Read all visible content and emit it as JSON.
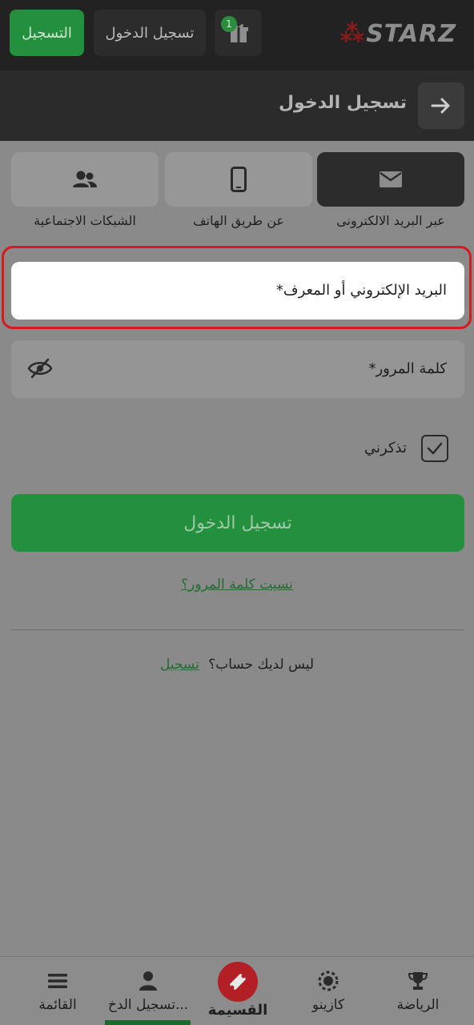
{
  "header": {
    "register_label": "التسجيل",
    "login_label": "تسجيل الدخول",
    "gift_count": "1",
    "logo_mark": "⁂",
    "logo_text": "STARZ"
  },
  "titlebar": {
    "title": "تسجيل الدخول"
  },
  "tabs": [
    {
      "label": "عبر البريد الالكترونى",
      "icon": "envelope-icon",
      "active": true
    },
    {
      "label": "عن طريق الهاتف",
      "icon": "phone-icon",
      "active": false
    },
    {
      "label": "الشبكات الاجتماعية",
      "icon": "users-icon",
      "active": false
    }
  ],
  "form": {
    "email_label": "البريد الإلكتروني أو المعرف*",
    "password_label": "كلمة المرور*",
    "remember_label": "تذكرني",
    "submit_label": "تسجيل الدخول",
    "forgot_label": "نسيت كلمة المرور؟",
    "no_account_text": "ليس لديك حساب؟",
    "register_link": "تسجيل"
  },
  "bottom_nav": [
    {
      "label": "الرياضة",
      "icon": "trophy-icon"
    },
    {
      "label": "كازينو",
      "icon": "casino-chip-icon"
    },
    {
      "label": "القسيمة",
      "icon": "ticket-icon"
    },
    {
      "label": "تسجيل الدخ...",
      "icon": "person-icon"
    },
    {
      "label": "القائمة",
      "icon": "menu-icon"
    }
  ],
  "colors": {
    "accent_green": "#23903d",
    "highlight_red": "#d71920",
    "coupon_red": "#b21f24"
  }
}
